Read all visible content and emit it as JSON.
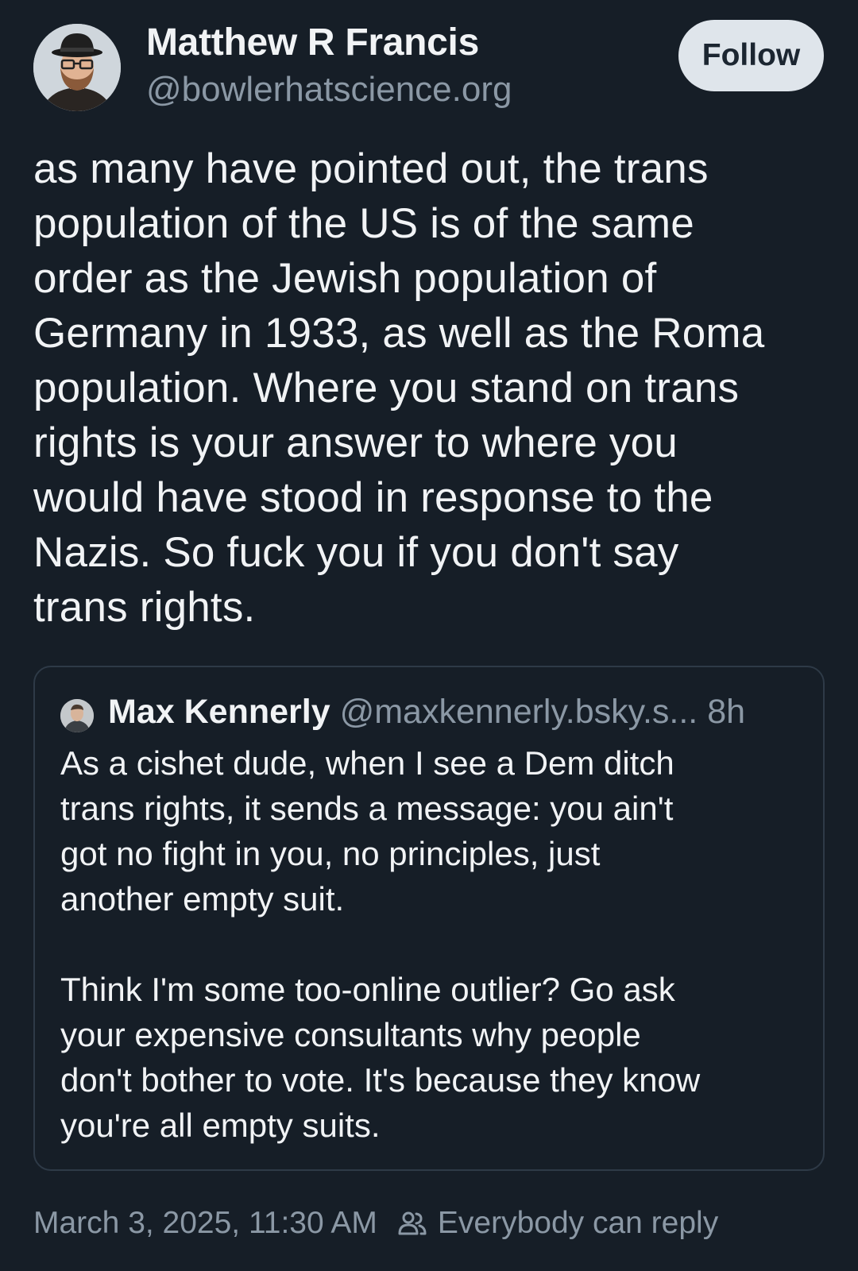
{
  "post": {
    "author": {
      "name": "Matthew R Francis",
      "handle": "@bowlerhatscience.org"
    },
    "follow_label": "Follow",
    "text": "as many have pointed out, the trans\npopulation of the US is of the same\norder as the Jewish population of\nGermany in 1933, as well as the Roma\npopulation. Where you stand on trans\nrights is your answer to where you\nwould have stood in response to the\nNazis. So fuck you if you don't say\ntrans rights.",
    "quote": {
      "author_name": "Max Kennerly",
      "handle": "@maxkennerly.bsky.s...",
      "time": "8h",
      "text": "As a cishet dude, when I see a Dem ditch\ntrans rights, it sends a message: you ain't\ngot no fight in you, no principles, just\nanother empty suit.\n\nThink I'm some too-online outlier? Go ask\nyour expensive consultants why people\ndon't bother to vote. It's because they know\nyou're all empty suits."
    },
    "timestamp": "March 3, 2025, 11:30 AM",
    "reply_setting": "Everybody can reply"
  },
  "icons": {
    "reply_setting_icon": "people-icon"
  },
  "colors": {
    "background": "#161e27",
    "text_primary": "#f1f3f5",
    "text_secondary": "#8b98a5",
    "follow_button_bg": "#dfe5eb",
    "card_border": "#2e3a47"
  }
}
